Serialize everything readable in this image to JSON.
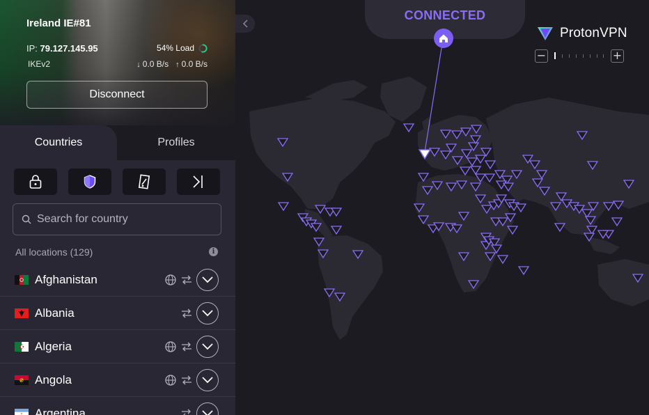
{
  "connection": {
    "server": "Ireland IE#81",
    "ip_label": "IP:",
    "ip": "79.127.145.95",
    "load": "54% Load",
    "load_fraction": 0.54,
    "protocol": "IKEv2",
    "download": "0.0 B/s",
    "upload": "0.0 B/s",
    "disconnect_label": "Disconnect"
  },
  "tabs": {
    "countries": "Countries",
    "profiles": "Profiles"
  },
  "filters": [
    {
      "icon": "lock-icon"
    },
    {
      "icon": "shield-icon"
    },
    {
      "icon": "p2p-tag-icon"
    },
    {
      "icon": "tor-exit-icon"
    }
  ],
  "search": {
    "placeholder": "Search for country"
  },
  "locations": {
    "label": "All locations (129)"
  },
  "countries": [
    {
      "name": "Afghanistan",
      "flag": "AF",
      "globe": true,
      "p2p": true
    },
    {
      "name": "Albania",
      "flag": "AL",
      "globe": false,
      "p2p": true
    },
    {
      "name": "Algeria",
      "flag": "DZ",
      "globe": true,
      "p2p": true
    },
    {
      "name": "Angola",
      "flag": "AO",
      "globe": true,
      "p2p": true
    },
    {
      "name": "Argentina",
      "flag": "AR",
      "globe": false,
      "p2p": true
    }
  ],
  "map": {
    "status": "CONNECTED",
    "logo_text": "ProtonVPN",
    "home_icon": "home-icon",
    "colors": {
      "accent": "#8b6cf6",
      "marker": "#7c5ef5",
      "land": "#2b2a33",
      "background": "#1c1b22"
    }
  }
}
